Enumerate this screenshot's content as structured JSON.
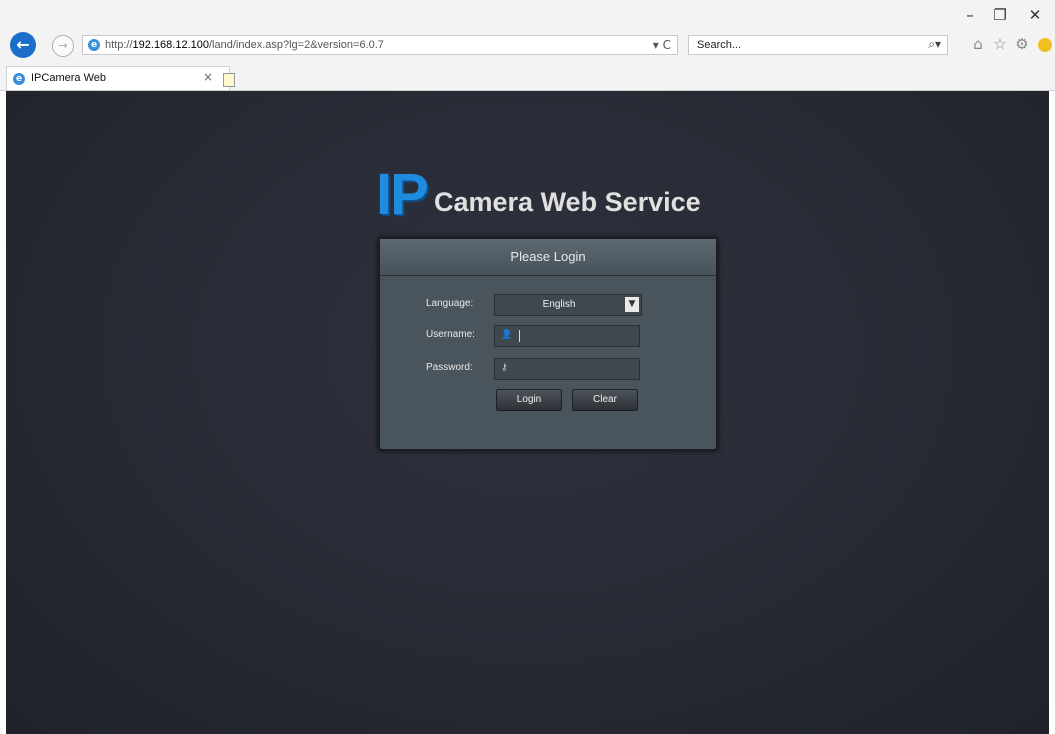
{
  "browser": {
    "window_controls": {
      "minimize": "–",
      "restore": "❐",
      "close": "✕"
    },
    "address": {
      "prefix": "http://",
      "host": "192.168.12.100",
      "path": "/land/index.asp?lg=2&version=6.0.7",
      "tools": "▾ C"
    },
    "search": {
      "placeholder": "Search..."
    },
    "tab": {
      "title": "IPCamera Web",
      "close": "×"
    }
  },
  "page": {
    "logo": {
      "ip": "IP",
      "rest": "Camera Web Service"
    },
    "login": {
      "title": "Please Login",
      "language_label": "Language:",
      "language_value": "English",
      "username_label": "Username:",
      "username_value": "",
      "password_label": "Password:",
      "password_value": "",
      "login_button": "Login",
      "clear_button": "Clear"
    }
  },
  "colors": {
    "accent": "#1f8ce0",
    "background": "#262932",
    "panel": "#4a545c"
  }
}
